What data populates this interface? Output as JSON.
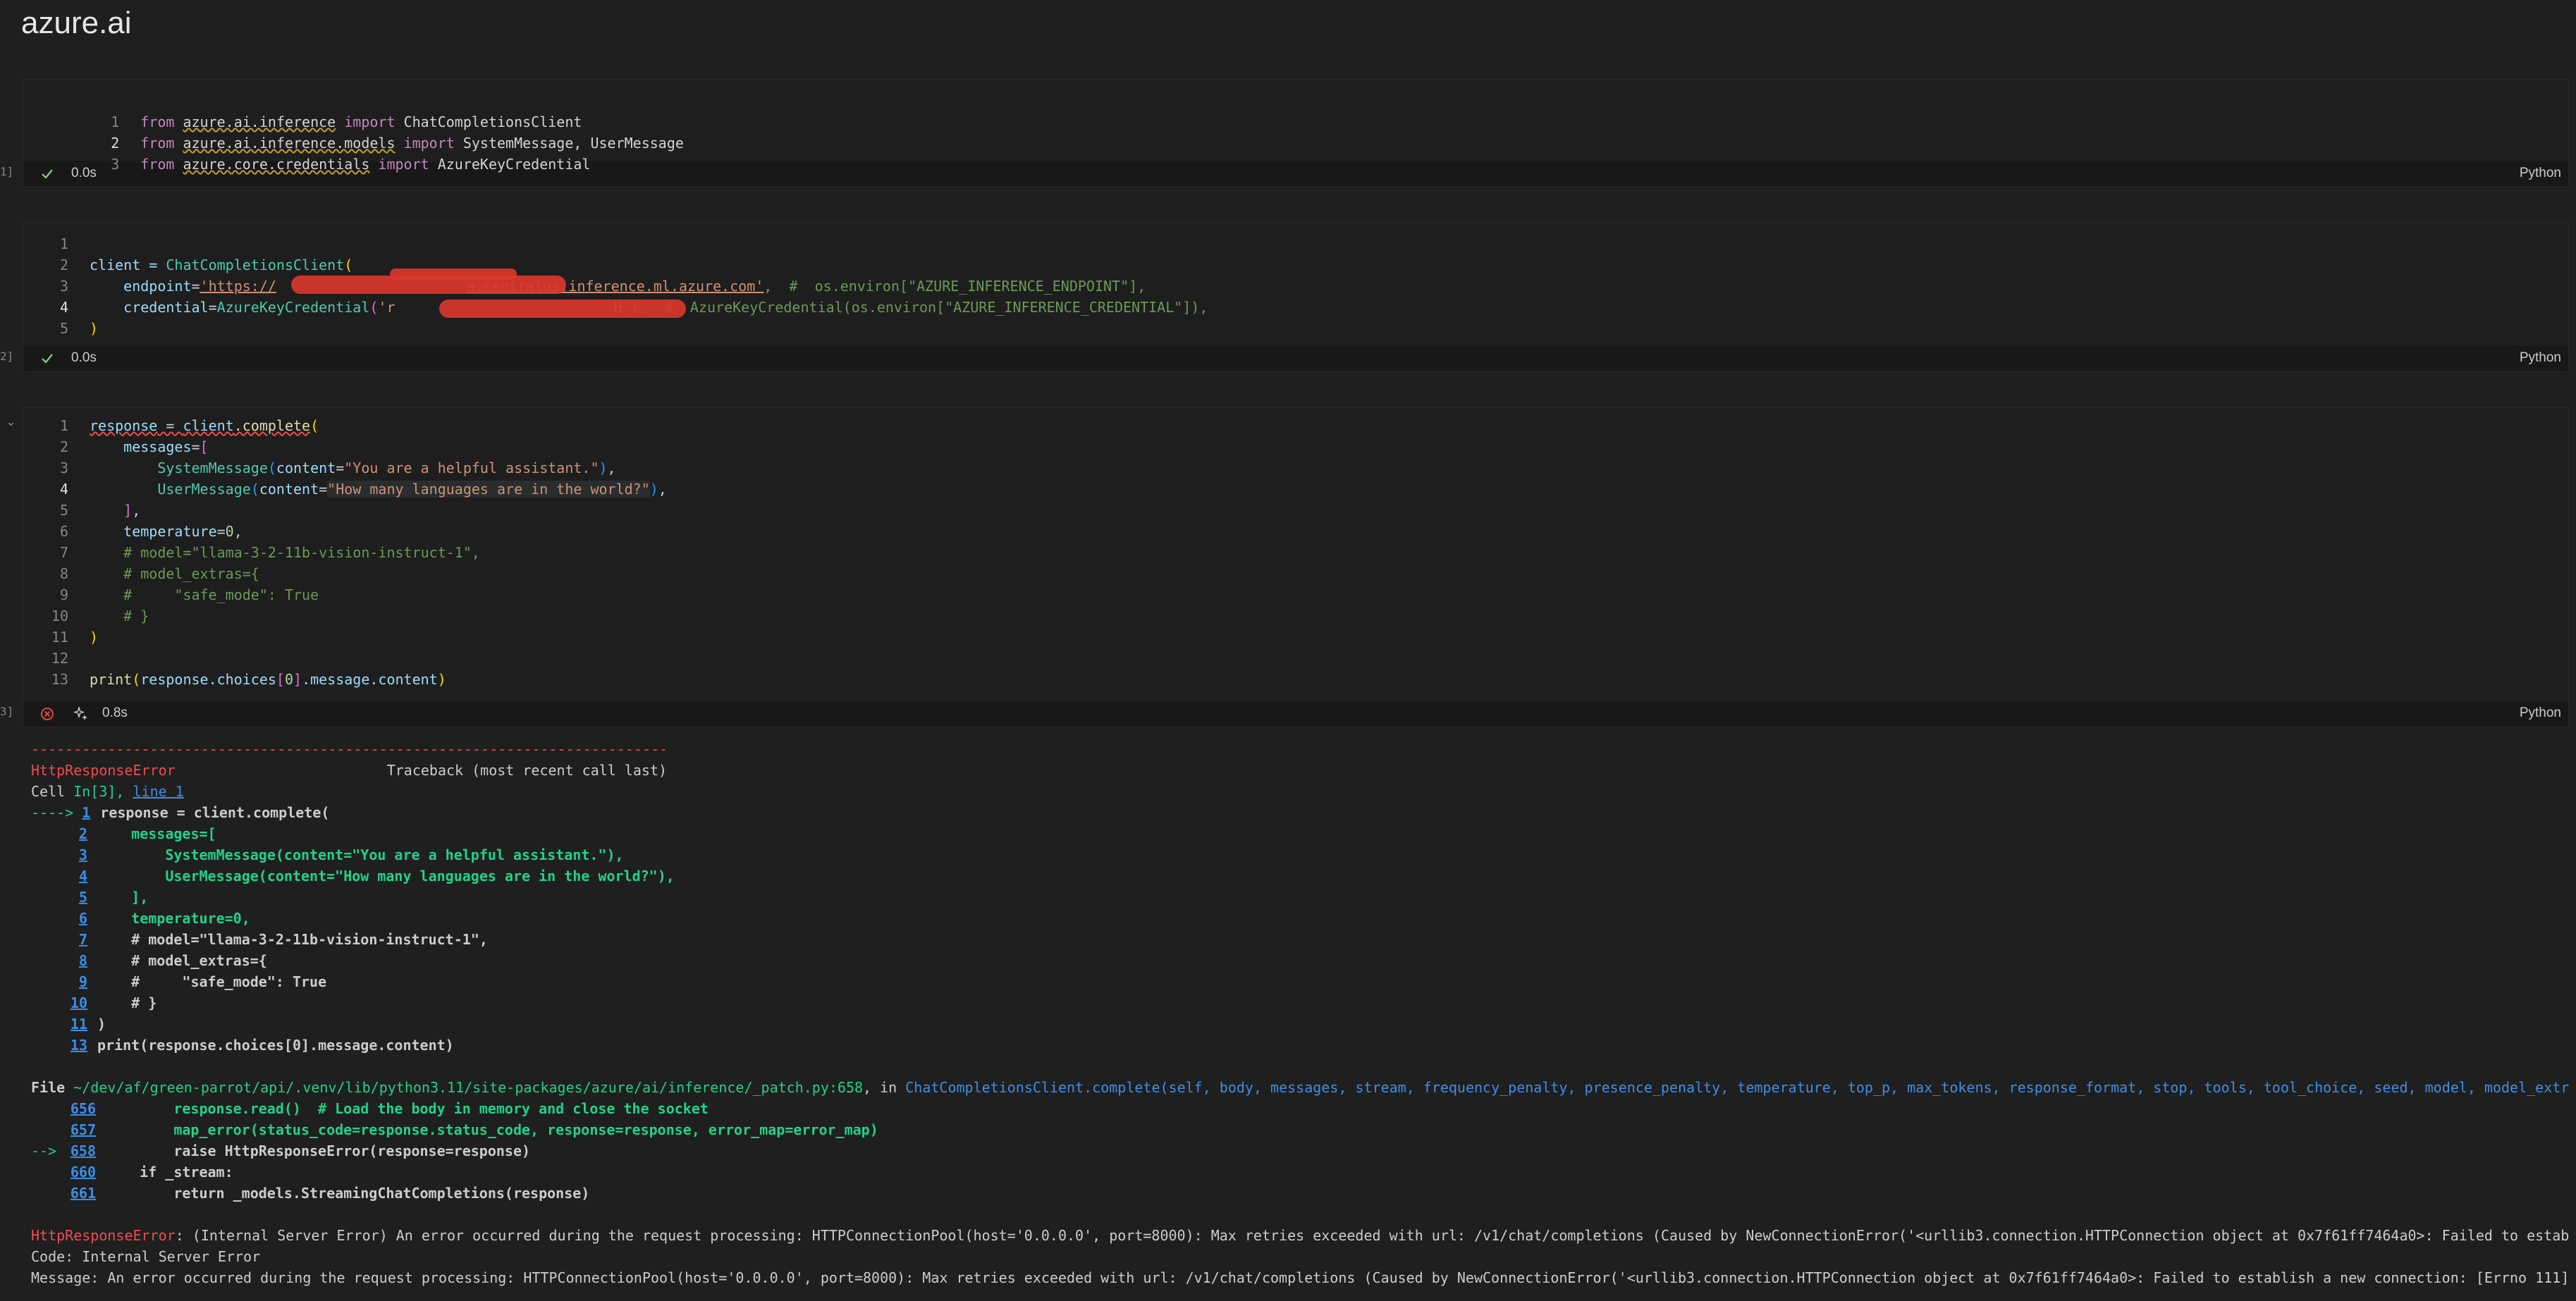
{
  "app": {
    "title": "azure.ai"
  },
  "cells": [
    {
      "exec_count": "1]",
      "status_time": "0.0s",
      "language": "Python",
      "lines": [
        {
          "n": "1"
        },
        {
          "n": "2"
        },
        {
          "n": "3"
        }
      ]
    },
    {
      "exec_count": "2]",
      "status_time": "0.0s",
      "language": "Python"
    },
    {
      "exec_count": "3]",
      "status_time": "0.8s",
      "language": "Python"
    }
  ],
  "code": {
    "c1": {
      "l1": [
        "from",
        "azure.ai.inference",
        "import",
        "ChatCompletionsClient"
      ],
      "l2": [
        "from",
        "azure.ai.inference.models",
        "import",
        "SystemMessage, UserMessage"
      ],
      "l3": [
        "from",
        "azure.core.credentials",
        "import",
        "AzureKeyCredential"
      ]
    },
    "c2": {
      "l2a": "client = ",
      "l2b": "ChatCompletionsClient",
      "l3a": "endpoint",
      "l3b": "'https://",
      "l3c": "a.centralus.inference.ml.azure.com'",
      "l3d": ",  #  os.environ[\"AZURE_INFERENCE_ENDPOINT\"],",
      "l4a": "credential",
      "l4b": "AzureKeyCredential",
      "l4c": "'r",
      "l4d": "H'",
      "l4e": "),  #  AzureKeyCredential(os.environ[\"AZURE_INFERENCE_CREDENTIAL\"]),"
    },
    "c3": {
      "l1a": "response",
      "l1b": " = ",
      "l1c": "client",
      "l1d": ".complete",
      "l2": "messages",
      "l3a": "SystemMessage",
      "l3b": "content",
      "l3c": "\"You are a helpful assistant.\"",
      "l4a": "UserMessage",
      "l4b": "content",
      "l4c": "\"How many languages are in the world?\"",
      "l6a": "temperature",
      "l6b": "0",
      "l7": "# model=\"llama-3-2-11b-vision-instruct-1\",",
      "l8": "# model_extras={",
      "l9": "#     \"safe_mode\": True",
      "l10": "# }",
      "l13a": "print",
      "l13b": "response",
      "l13c": ".choices",
      "l13d": "0",
      "l13e": ".message.content"
    }
  },
  "output": {
    "dashes": "---------------------------------------------------------------------------",
    "error_name": "HttpResponseError",
    "traceback_header": "Traceback (most recent call last)",
    "cell_prefix": "Cell ",
    "cell_ref": "In[3], ",
    "cell_line": "line 1",
    "arrow1": "----> ",
    "tb_lines": [
      {
        "n": "1",
        "text": "response = client.complete("
      },
      {
        "n": "2",
        "text": "    messages=["
      },
      {
        "n": "3",
        "text": "        SystemMessage(content=\"You are a helpful assistant.\"),"
      },
      {
        "n": "4",
        "text": "        UserMessage(content=\"How many languages are in the world?\"),"
      },
      {
        "n": "5",
        "text": "    ],"
      },
      {
        "n": "6",
        "text": "    temperature=0,"
      },
      {
        "n": "7",
        "text": "    # model=\"llama-3-2-11b-vision-instruct-1\","
      },
      {
        "n": "8",
        "text": "    # model_extras={"
      },
      {
        "n": "9",
        "text": "    #     \"safe_mode\": True"
      },
      {
        "n": "10",
        "text": "    # }"
      },
      {
        "n": "11",
        "text": ")"
      },
      {
        "n": "13",
        "text": "print(response.choices[0].message.content)"
      }
    ],
    "file_label": "File ",
    "file_path": "~/dev/af/green-parrot/api/.venv/lib/python3.11/site-packages/azure/ai/inference/_patch.py:658",
    "file_in": ", in ",
    "file_func": "ChatCompletionsClient.complete",
    "file_args": "(self, body, messages, stream, frequency_penalty, presence_penalty, temperature, top_p, max_tokens, response_format, stop, tools, tool_choice, seed, model, model_extr",
    "src_lines": [
      {
        "n": "656",
        "arrow": "",
        "text": "        response.read()  # Load the body in memory and close the socket"
      },
      {
        "n": "657",
        "arrow": "",
        "text": "        map_error(status_code=response.status_code, response=response, error_map=error_map)"
      },
      {
        "n": "658",
        "arrow": "--> ",
        "text": "        raise HttpResponseError(response=response)"
      },
      {
        "n": "660",
        "arrow": "",
        "text": "    if _stream:"
      },
      {
        "n": "661",
        "arrow": "",
        "text": "        return _models.StreamingChatCompletions(response)"
      }
    ],
    "final_err_name": "HttpResponseError",
    "final_err_msg": ": (Internal Server Error) An error occurred during the request processing: HTTPConnectionPool(host='0.0.0.0', port=8000): Max retries exceeded with url: /v1/chat/completions (Caused by NewConnectionError('<urllib3.connection.HTTPConnection object at 0x7f61ff7464a0>: Failed to estab",
    "code_line": "Code: Internal Server Error",
    "message_line": "Message: An error occurred during the request processing: HTTPConnectionPool(host='0.0.0.0', port=8000): Max retries exceeded with url: /v1/chat/completions (Caused by NewConnectionError('<urllib3.connection.HTTPConnection object at 0x7f61ff7464a0>: Failed to establish a new connection: [Errno 111]"
  },
  "icons": {
    "success": "check-icon",
    "error": "error-circle-icon",
    "sparkle": "sparkle-icon",
    "collapse": "chevron-down-icon"
  },
  "colors": {
    "background": "#1f1f1f",
    "error": "#f14c4c",
    "success": "#89d185",
    "link": "#3b8eea"
  }
}
